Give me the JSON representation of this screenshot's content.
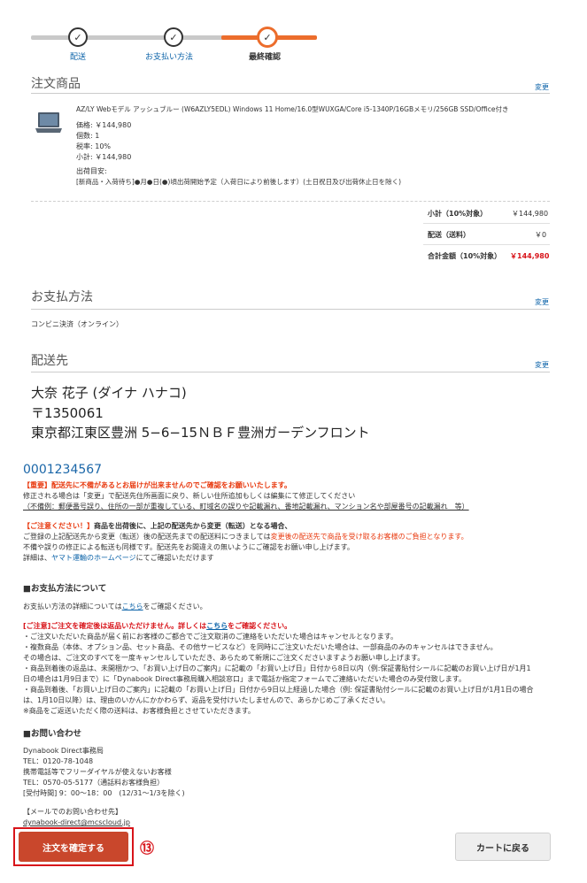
{
  "stepper": {
    "steps": [
      {
        "label": "配送",
        "check": "✓"
      },
      {
        "label": "お支払い方法",
        "check": "✓"
      },
      {
        "label": "最終確認",
        "check": "✓"
      }
    ],
    "colors": {
      "done": "#c9c9c9",
      "active": "#ec6d2c",
      "label_link": "#0a62a8"
    }
  },
  "order": {
    "title": "注文商品",
    "change": "変更",
    "product_name": "AZ/LY Webモデル アッシュブルー (W6AZLY5EDL) Windows 11 Home/16.0型WUXGA/Core i5-1340P/16GBメモリ/256GB SSD/Office付き",
    "price": "価格: ￥144,980",
    "qty": "個数: 1",
    "tax": "税率: 10%",
    "subtotal": "小計: ￥144,980",
    "ship_label": "出荷目安:",
    "ship_note": "[新商品・入荷待ち]●月●日(●)頃出荷開始予定（入荷日により前後します）(土日祝日及び出荷休止日を除く)"
  },
  "summary": {
    "rows": [
      {
        "label": "小計（10%対象）",
        "value": "￥144,980"
      },
      {
        "label": "配送（送料）",
        "value": "￥0"
      },
      {
        "label": "合計金額（10%対象）",
        "value": "￥144,980"
      }
    ]
  },
  "payment": {
    "title": "お支払方法",
    "change": "変更",
    "method": "コンビニ決済（オンライン）"
  },
  "shipping": {
    "title": "配送先",
    "change": "変更",
    "name": "大奈 花子 (ダイナ ハナコ)",
    "zip": "〒1350061",
    "address": "東京都江東区豊洲 5−6−15ＮＢＦ豊洲ガーデンフロント"
  },
  "notes": {
    "phone": "0001234567",
    "important1": "【重要】配送先に不備があるとお届けが出来ませんのでご確認をお願いいたします。",
    "important2": "修正される場合は「変更」で配送先住所画面に戻り、新しい住所追加もしくは編集にて修正してください",
    "important3": "（不備例：郵便番号誤り、住所の一部が重複している、町域名の誤りや記載漏れ、番地記載漏れ、マンション名や部屋番号の記載漏れ　等）",
    "caution_a": "【ご注意ください！】",
    "caution_b": "商品を出荷後に、上記の配送先から変更（転送）となる場合、",
    "caution2a": "ご登録の上記配送先から変更（転送）後の配送先までの配送料につきましては",
    "caution2b": "変更後の配送先で商品を受け取るお客様のご負担となります。",
    "caution3": "不備や誤りの修正による転送も同様です。配送先をお間違えの無いようにご確認をお願い申し上げます。",
    "caution4a": "詳細は、",
    "caution4link": "ヤマト運輸のホームページ",
    "caution4b": "にてご確認いただけます"
  },
  "payinfo": {
    "heading": "■お支払方法について",
    "line_a": "お支払い方法の詳細については",
    "line_link": "こちら",
    "line_b": "をご確認ください。",
    "warn_a": "[ご注意]ご注文を確定後は返品いただけません。詳しくは",
    "warn_link": "こちら",
    "warn_b": "をご確認ください。",
    "bullets": [
      "・ご注文いただいた商品が届く前にお客様のご都合でご注文取消のご連絡をいただいた場合はキャンセルとなります。",
      "・複数商品（本体、オプション品、セット商品、その他サービスなど）を同時にご注文いただいた場合は、一部商品のみのキャンセルはできません。",
      "その場合は、ご注文のすべてを一度キャンセルしていただき、あらためて新規にご注文くださいますようお願い申し上げます。",
      "・商品到着後の返品は、未開梱かつ、「お買い上げ日のご案内」に記載の「お買い上げ日」日付から8日以内（例:保証書貼付シールに記載のお買い上げ日が1月1",
      "日の場合は1月9日まで）に「Dynabook Direct事務局購入相談窓口」まで電話か指定フォームでご連絡いただいた場合のみ受付致します。",
      "・商品到着後、「お買い上げ日のご案内」に記載の「お買い上げ日」日付から9日以上経過した場合（例: 保証書貼付シールに記載のお買い上げ日が1月1日の場合",
      "は、1月10日以降）は、理由のいかんにかかわらず、返品を受付けいたしませんので、あらかじめご了承ください。",
      "※商品をご返送いただく際の送料は、お客様負担とさせていただきます。"
    ]
  },
  "contact": {
    "heading": "■お問い合わせ",
    "lines": [
      "Dynabook Direct事務局",
      "TEL：0120-78-1048",
      "携帯電話等でフリーダイヤルが使えないお客様",
      "TEL：0570-05-5177（通話料お客様負担）",
      "[受付時間] 9：00〜18：00　(12/31〜1/3を除く)"
    ],
    "mail_heading": "【メールでのお問い合わせ先】",
    "mail": "dynabook-direct@mcscloud.jp"
  },
  "buttons": {
    "confirm": "注文を確定する",
    "back": "カートに戻る",
    "marker": "⑬"
  }
}
